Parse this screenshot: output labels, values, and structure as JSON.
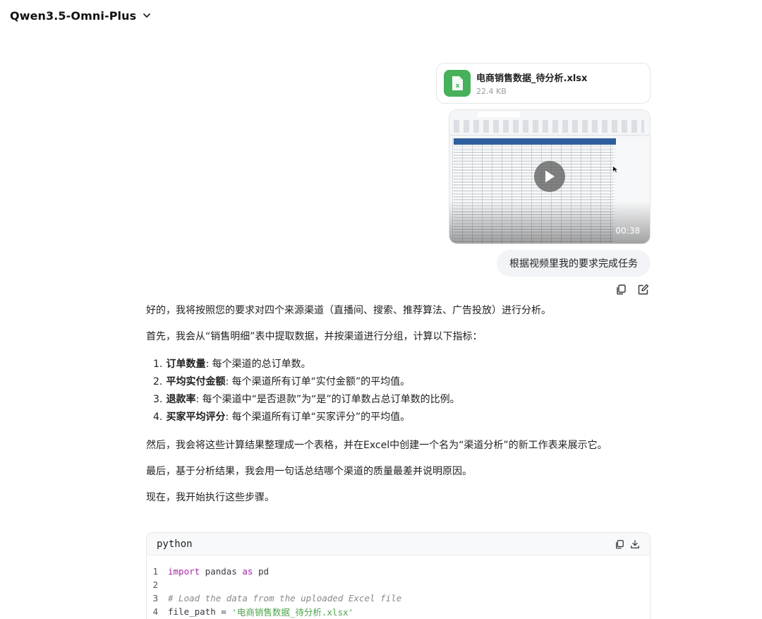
{
  "header": {
    "model_name": "Qwen3.5-Omni-Plus"
  },
  "attachment": {
    "file_name": "电商销售数据_待分析.xlsx",
    "file_size": "22.4 KB",
    "icon": "excel-file-icon",
    "accent": "#46b05b"
  },
  "video": {
    "duration": "00:38",
    "icon": "play-icon"
  },
  "user_message": {
    "text": "根据视频里我的要求完成任务"
  },
  "assistant": {
    "intro": "好的，我将按照您的要求对四个来源渠道（直播间、搜索、推荐算法、广告投放）进行分析。",
    "step1": "首先，我会从“销售明细”表中提取数据，并按渠道进行分组，计算以下指标：",
    "metrics": [
      {
        "num": "1.",
        "name": "订单数量",
        "desc": ": 每个渠道的总订单数。"
      },
      {
        "num": "2.",
        "name": "平均实付金额",
        "desc": ": 每个渠道所有订单“实付金额”的平均值。"
      },
      {
        "num": "3.",
        "name": "退款率",
        "desc": ": 每个渠道中“是否退款”为“是”的订单数占总订单数的比例。"
      },
      {
        "num": "4.",
        "name": "买家平均评分",
        "desc": ": 每个渠道所有订单“买家评分”的平均值。"
      }
    ],
    "step2": "然后，我会将这些计算结果整理成一个表格，并在Excel中创建一个名为“渠道分析”的新工作表来展示它。",
    "step3": "最后，基于分析结果，我会用一句话总结哪个渠道的质量最差并说明原因。",
    "step4": "现在，我开始执行这些步骤。"
  },
  "code_block": {
    "language": "python",
    "lines": [
      {
        "n": "1",
        "kw1": "import",
        "mid": " pandas ",
        "kw2": "as",
        "end": " pd"
      },
      {
        "n": "2"
      },
      {
        "n": "3",
        "comment": "# Load the data from the uploaded Excel file"
      },
      {
        "n": "4",
        "code": "file_path = ",
        "string": "'电商销售数据_待分析.xlsx'"
      }
    ]
  }
}
